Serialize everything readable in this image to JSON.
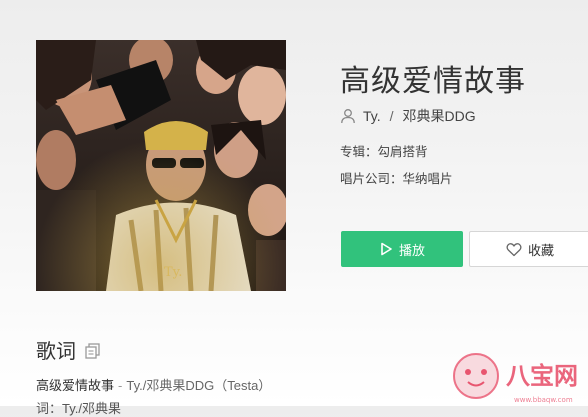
{
  "song": {
    "title": "高级爱情故事",
    "artist": "Ty.",
    "separator": "/",
    "artist2": "邓典果DDG",
    "album_label": "专辑：",
    "album": "勾肩搭背",
    "label_label": "唱片公司：",
    "label": "华纳唱片"
  },
  "actions": {
    "play_label": "播放",
    "favorite_label": "收藏"
  },
  "lyrics": {
    "heading": "歌词",
    "line1_title": "高级爱情故事",
    "line1_dash": "-",
    "line1_credits": "Ty./邓典果DDG（Testa）",
    "line2": "词：Ty./邓典果"
  },
  "watermark": {
    "text": "八宝网",
    "url": "www.bbaqw.com"
  },
  "colors": {
    "accent": "#31c27c",
    "watermark": "#e8556f"
  },
  "icons": {
    "artist": "user-icon",
    "play": "play-icon",
    "favorite": "heart-icon",
    "copy": "copy-icon"
  }
}
